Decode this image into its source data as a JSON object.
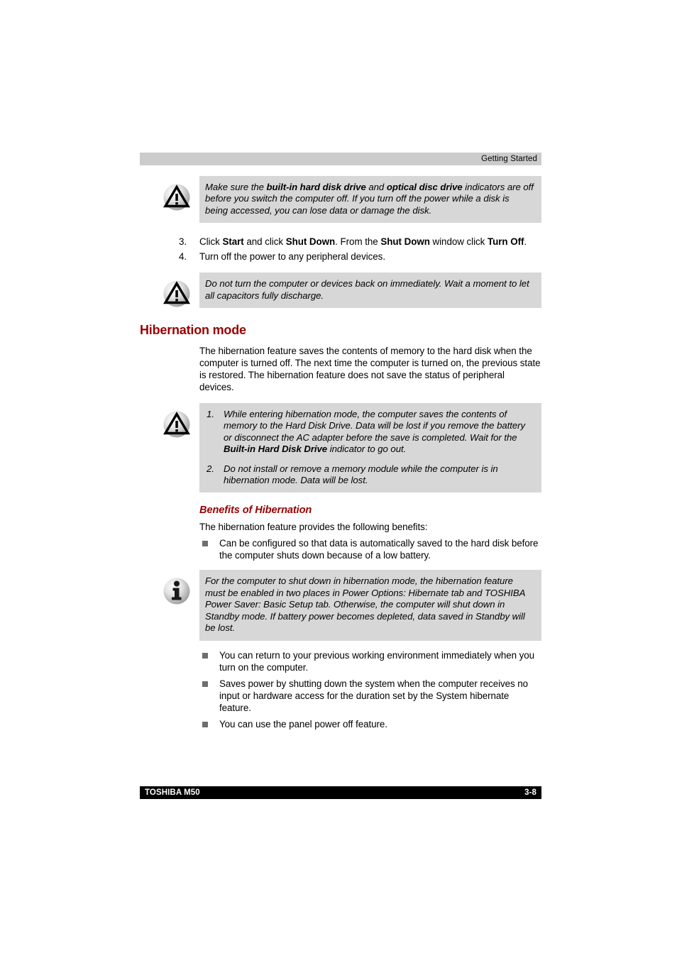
{
  "header": {
    "chapter_title": "Getting Started"
  },
  "footer": {
    "product": "TOSHIBA M50",
    "page_number": "3-8"
  },
  "colors": {
    "heading_red": "#990000",
    "note_background": "#d7d7d7",
    "header_background": "#cccccc",
    "footer_background": "#000000",
    "bullet_square": "#6e6e6e"
  },
  "icons": {
    "caution": "warning-triangle-icon",
    "note": "info-i-icon"
  },
  "notes": {
    "caution_disk": {
      "line1_a": "Make sure the ",
      "line1_b": "built-in hard disk drive",
      "line1_c": " and ",
      "line1_d": "optical disc drive",
      "line1_e": " indicators are off before you switch the computer off. If you turn off the power while a disk is being accessed, you can lose data or damage the disk."
    },
    "caution_capacitors": {
      "text": "Do not turn the computer or devices back on immediately. Wait a moment to let all capacitors fully discharge."
    },
    "caution_hibernation": {
      "items": [
        {
          "num": "1.",
          "a": "While entering hibernation mode, the computer saves the contents of memory to the Hard Disk Drive. Data will be lost if you remove the battery or disconnect the AC adapter before the save is completed. Wait for the ",
          "b": "Built-in Hard Disk Drive",
          "c": " indicator to go out."
        },
        {
          "num": "2.",
          "a": "Do not install or remove a memory module while the computer is in hibernation mode. Data will be lost.",
          "b": "",
          "c": ""
        }
      ]
    },
    "info_power_options": {
      "text": "For the computer to shut down in hibernation mode, the hibernation feature must be enabled in two places in Power Options: Hibernate tab and TOSHIBA Power Saver: Basic Setup tab. Otherwise, the computer will shut down in Standby mode. If battery power becomes depleted, data saved in Standby will be lost."
    }
  },
  "steps": [
    {
      "num": "3.",
      "a": "Click ",
      "b": "Start",
      "c": " and click ",
      "d": "Shut Down",
      "e": ". From the ",
      "f": "Shut Down",
      "g": " window click ",
      "h": "Turn Off",
      "i": "."
    },
    {
      "num": "4.",
      "a": "Turn off the power to any peripheral devices.",
      "b": "",
      "c": "",
      "d": "",
      "e": "",
      "f": "",
      "g": "",
      "h": "",
      "i": ""
    }
  ],
  "sections": {
    "hibernation_mode": {
      "heading": "Hibernation mode",
      "intro": "The hibernation feature saves the contents of memory to the hard disk when the computer is turned off. The next time the computer is turned on, the previous state is restored. The hibernation feature does not save the status of peripheral devices."
    },
    "benefits": {
      "heading": "Benefits of Hibernation",
      "intro": "The hibernation feature provides the following benefits:",
      "bullets_before_note": [
        "Can be configured so that data is automatically saved to the hard disk before the computer shuts down because of a low battery."
      ],
      "bullets_after_note": [
        "You can return to your previous working environment immediately when you turn on the computer.",
        "Saves power by shutting down the system when the computer receives no input or hardware access for the duration set by the System hibernate feature.",
        "You can use the panel power off feature."
      ]
    }
  }
}
